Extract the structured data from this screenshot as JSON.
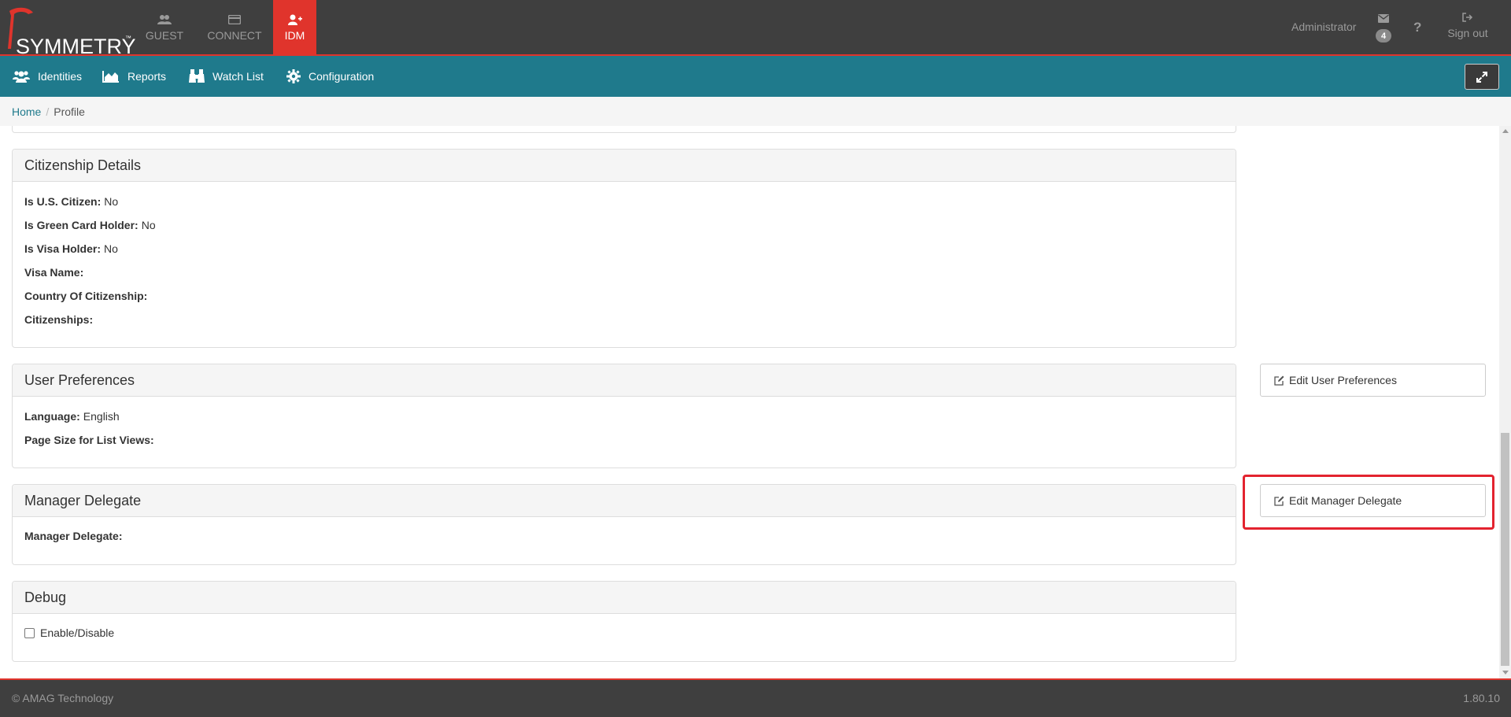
{
  "header": {
    "logo_text": "SYMMETRY",
    "logo_tm": "™",
    "apps": [
      {
        "label": "GUEST"
      },
      {
        "label": "CONNECT"
      },
      {
        "label": "IDM"
      }
    ],
    "user": "Administrator",
    "mail_count": "4",
    "help": "?",
    "signout": "Sign out"
  },
  "nav": {
    "items": [
      {
        "label": "Identities"
      },
      {
        "label": "Reports"
      },
      {
        "label": "Watch List"
      },
      {
        "label": "Configuration"
      }
    ]
  },
  "breadcrumb": {
    "home": "Home",
    "separator": "/",
    "current": "Profile"
  },
  "panels": {
    "citizenship": {
      "title": "Citizenship Details",
      "fields": [
        {
          "label": "Is U.S. Citizen:",
          "value": "No"
        },
        {
          "label": "Is Green Card Holder:",
          "value": "No"
        },
        {
          "label": "Is Visa Holder:",
          "value": "No"
        },
        {
          "label": "Visa Name:",
          "value": ""
        },
        {
          "label": "Country Of Citizenship:",
          "value": ""
        },
        {
          "label": "Citizenships:",
          "value": ""
        }
      ]
    },
    "preferences": {
      "title": "User Preferences",
      "edit_label": "Edit User Preferences",
      "fields": [
        {
          "label": "Language:",
          "value": "English"
        },
        {
          "label": "Page Size for List Views:",
          "value": ""
        }
      ]
    },
    "delegate": {
      "title": "Manager Delegate",
      "edit_label": "Edit Manager Delegate",
      "fields": [
        {
          "label": "Manager Delegate:",
          "value": ""
        }
      ]
    },
    "debug": {
      "title": "Debug",
      "checkbox_label": "Enable/Disable"
    }
  },
  "footer": {
    "copyright": "© AMAG Technology",
    "version": "1.80.10"
  },
  "colors": {
    "topbar": "#3f3f3f",
    "accent_red": "#e0342c",
    "navbar": "#1f7a8c",
    "highlight": "#e3232f"
  }
}
